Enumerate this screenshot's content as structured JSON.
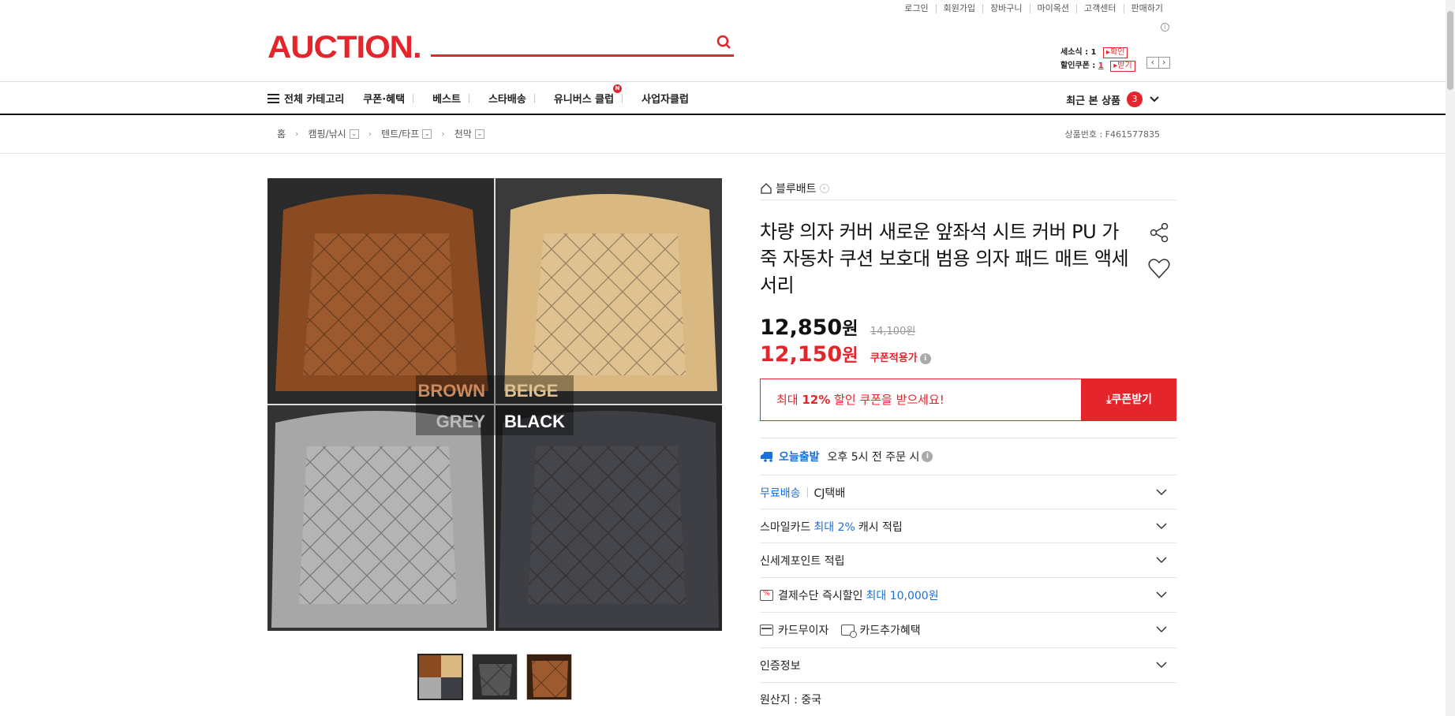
{
  "header": {
    "util_links": [
      "로그인",
      "회원가입",
      "장바구니",
      "마이옥션",
      "고객센터",
      "판매하기"
    ],
    "logo": "AUCTION.",
    "search_placeholder": "",
    "mini": {
      "receipt_label": "세소식 : 1",
      "receipt_btn": "확인",
      "coupon_label": "할인쿠폰 : ",
      "coupon_count": "1",
      "coupon_btn": "받기"
    }
  },
  "nav": {
    "all_category": "전체 카테고리",
    "items": [
      "쿠폰·혜택",
      "베스트",
      "스타배송",
      "유니버스 클럽",
      "사업자클럽"
    ],
    "badge": "N",
    "recent_label": "최근 본 상품",
    "recent_count": "3"
  },
  "breadcrumb": {
    "home": "홈",
    "items": [
      "캠핑/낚시",
      "텐트/타프",
      "천막"
    ],
    "product_no": "상품번호 : F461577835"
  },
  "gallery": {
    "labels": [
      "BROWN",
      "BEIGE",
      "GREY",
      "BLACK"
    ]
  },
  "product": {
    "store": "블루배트",
    "title": "차량 의자 커버 새로운 앞좌석 시트 커버 PU 가죽 자동차 쿠션 보호대 범용 의자 패드 매트 액세서리",
    "price": "12,850",
    "won": "원",
    "orig_price": "14,100원",
    "coupon_price": "12,150",
    "coupon_tag": "쿠폰적용가",
    "coupon_msg_pre": "최대 ",
    "coupon_msg_pct": "12%",
    "coupon_msg_post": " 할인 쿠폰을 받으세요!",
    "coupon_btn": "쿠폰받기",
    "today_label": "오늘출발",
    "today_desc": "오후 5시 전 주문 시",
    "ship_free": "무료배송",
    "ship_co": "CJ택배",
    "smile_pre": "스마일카드 ",
    "smile_blue": "최대 2%",
    "smile_post": " 캐시 적립",
    "ssg": "신세계포인트 적립",
    "pay_pre": "결제수단 즉시할인 ",
    "pay_blue": "최대 10,000원",
    "card_free": "카드무이자",
    "card_extra": "카드추가혜택",
    "cert": "인증정보",
    "origin": "원산지 : 중국"
  },
  "colors": {
    "brand": "#e4262c",
    "blue": "#1a6fd8"
  }
}
